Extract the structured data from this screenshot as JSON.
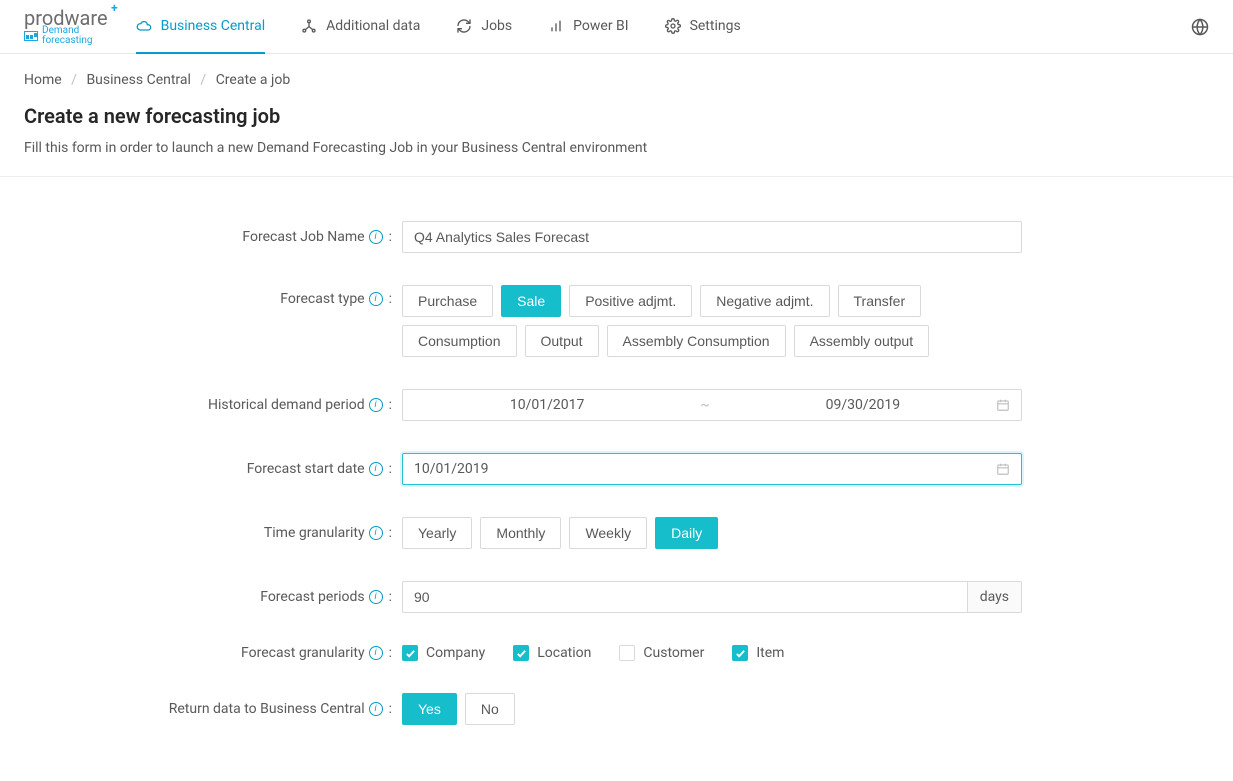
{
  "logo": {
    "brand": "prodware",
    "sub1": "Demand",
    "sub2": "forecasting"
  },
  "nav": {
    "business_central": "Business Central",
    "additional_data": "Additional data",
    "jobs": "Jobs",
    "power_bi": "Power BI",
    "settings": "Settings"
  },
  "breadcrumb": {
    "home": "Home",
    "bc": "Business Central",
    "current": "Create a job"
  },
  "page": {
    "title": "Create a new forecasting job",
    "subtitle": "Fill this form in order to launch a new Demand Forecasting Job in your Business Central environment"
  },
  "labels": {
    "forecast_job_name": "Forecast Job Name",
    "forecast_type": "Forecast type",
    "historical_period": "Historical demand period",
    "forecast_start": "Forecast start date",
    "time_granularity": "Time granularity",
    "forecast_periods": "Forecast periods",
    "forecast_granularity": "Forecast granularity",
    "return_data": "Return data to Business Central"
  },
  "values": {
    "job_name": "Q4 Analytics Sales Forecast",
    "hist_start": "10/01/2017",
    "hist_end": "09/30/2019",
    "forecast_start": "10/01/2019",
    "periods": "90",
    "periods_suffix": "days"
  },
  "forecast_types": {
    "purchase": "Purchase",
    "sale": "Sale",
    "positive_adj": "Positive adjmt.",
    "negative_adj": "Negative adjmt.",
    "transfer": "Transfer",
    "consumption": "Consumption",
    "output": "Output",
    "assembly_consumption": "Assembly Consumption",
    "assembly_output": "Assembly output"
  },
  "granularities_time": {
    "yearly": "Yearly",
    "monthly": "Monthly",
    "weekly": "Weekly",
    "daily": "Daily"
  },
  "granularities_dim": {
    "company": "Company",
    "location": "Location",
    "customer": "Customer",
    "item": "Item"
  },
  "return_opts": {
    "yes": "Yes",
    "no": "No"
  }
}
